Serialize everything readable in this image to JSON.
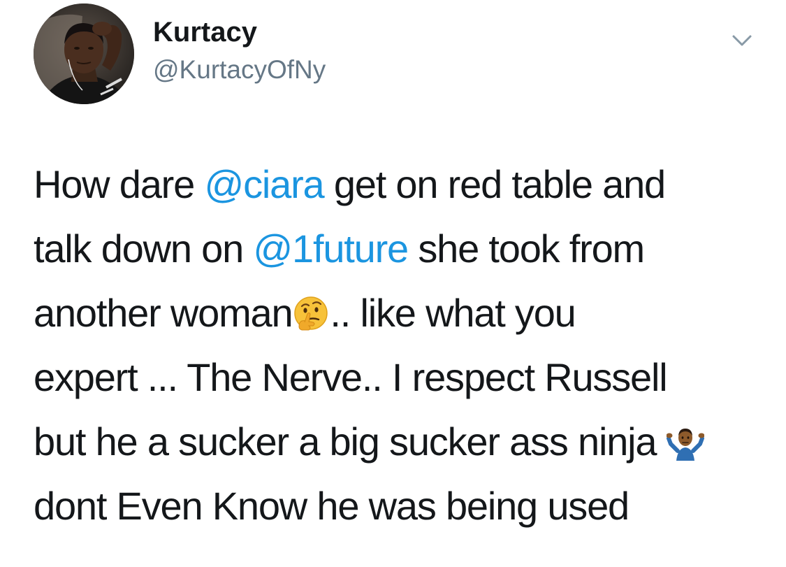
{
  "author": {
    "display_name": "Kurtacy",
    "handle": "@KurtacyOfNy",
    "avatar_icon": "profile-photo"
  },
  "menu": {
    "icon": "chevron-down-icon"
  },
  "tweet": {
    "lines": [
      {
        "a": "How dare ",
        "mention": "@ciara",
        "b": " get on red table and"
      },
      {
        "a": "talk down on ",
        "mention": "@1future",
        "b": " she took from"
      },
      {
        "a": "another woman",
        "emoji": "thinking-face-emoji",
        "b": ".. like what you"
      },
      {
        "text": "expert ... The Nerve.. I respect Russell"
      },
      {
        "a": "but he a sucker a big sucker ass ninja ",
        "emoji": "man-shrugging-emoji"
      },
      {
        "text": "dont Even Know he was being used"
      }
    ]
  },
  "colors": {
    "text": "#14171a",
    "secondary": "#657786",
    "link": "#1b95e0",
    "background": "#ffffff"
  }
}
